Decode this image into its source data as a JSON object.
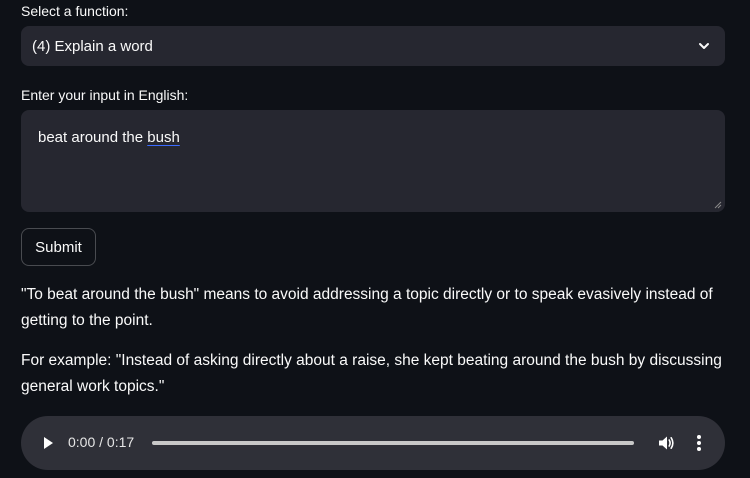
{
  "function_select": {
    "label": "Select a function:",
    "selected": "(4) Explain a word",
    "chevron_icon": "chevron-down-icon"
  },
  "input": {
    "label": "Enter your input in English:",
    "value_prefix": "beat around the ",
    "value_misspelled": "bush"
  },
  "submit": {
    "label": "Submit"
  },
  "output": {
    "meaning": "\"To beat around the bush\" means to avoid addressing a topic directly or to speak evasively instead of getting to the point.",
    "example": "For example: \"Instead of asking directly about a raise, she kept beating around the bush by discussing general work topics.\""
  },
  "audio": {
    "time_display": "0:00 / 0:17",
    "progress_fraction": 0,
    "play_icon": "play-icon",
    "volume_icon": "volume-icon",
    "more_icon": "more-vertical-icon"
  },
  "colors": {
    "background": "#0e1117",
    "widget_bg": "#262730",
    "text": "#fafafa",
    "spellcheck_underline": "#3b6bff",
    "audio_bg": "#2f3038"
  }
}
